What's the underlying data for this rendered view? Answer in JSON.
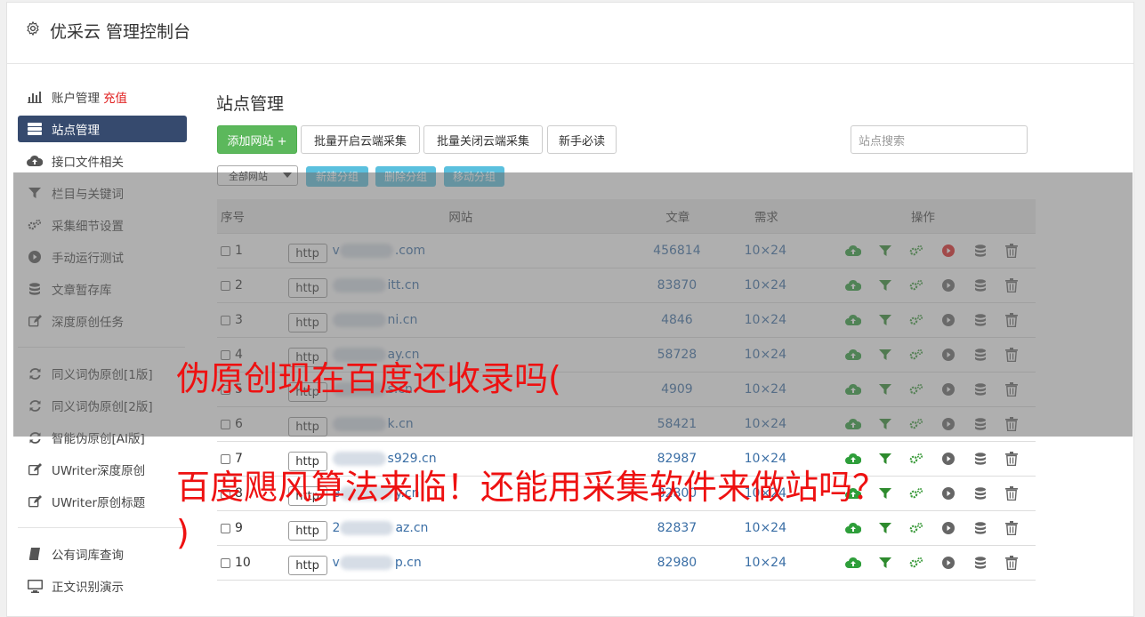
{
  "header": {
    "title": "优采云 管理控制台",
    "icon": "gear-icon"
  },
  "sidebar": {
    "items": [
      {
        "label": "账户管理",
        "extra": "充值",
        "icon": "bar-chart-icon"
      },
      {
        "label": "站点管理",
        "icon": "server-icon",
        "active": true
      },
      {
        "label": "接口文件相关",
        "icon": "cloud-upload-icon"
      },
      {
        "label": "栏目与关键词",
        "icon": "filter-icon"
      },
      {
        "label": "采集细节设置",
        "icon": "cogs-icon"
      },
      {
        "label": "手动运行测试",
        "icon": "play-icon"
      },
      {
        "label": "文章暂存库",
        "icon": "database-icon"
      },
      {
        "label": "深度原创任务",
        "icon": "edit-icon"
      }
    ],
    "items2": [
      {
        "label": "同义词伪原创[1版]",
        "icon": "refresh-icon"
      },
      {
        "label": "同义词伪原创[2版]",
        "icon": "refresh-icon"
      },
      {
        "label": "智能伪原创[AI版]",
        "icon": "refresh-icon"
      },
      {
        "label": "UWriter深度原创",
        "icon": "edit-icon"
      },
      {
        "label": "UWriter原创标题",
        "icon": "edit-icon"
      }
    ],
    "items3": [
      {
        "label": "公有词库查询",
        "icon": "book-icon"
      },
      {
        "label": "正文识别演示",
        "icon": "monitor-icon"
      }
    ]
  },
  "main": {
    "title": "站点管理",
    "buttons": {
      "add_site": "添加网站 +",
      "batch_open": "批量开启云端采集",
      "batch_close": "批量关闭云端采集",
      "newbie": "新手必读"
    },
    "search_placeholder": "站点搜索",
    "group_select": "全部网站",
    "group_buttons": {
      "new": "新建分组",
      "delete": "删除分组",
      "move": "移动分组"
    },
    "table": {
      "headers": {
        "no": "序号",
        "site": "网站",
        "articles": "文章",
        "demand": "需求",
        "ops": "操作"
      },
      "rows": [
        {
          "no": "1",
          "http": "http",
          "domain": ".com",
          "prefix": "v",
          "articles": "456814",
          "demand": "10×24",
          "play_active": true
        },
        {
          "no": "2",
          "http": "http",
          "domain": "itt.cn",
          "prefix": "",
          "articles": "83870",
          "demand": "10×24"
        },
        {
          "no": "3",
          "http": "http",
          "domain": "ni.cn",
          "prefix": "",
          "articles": "4846",
          "demand": "10×24"
        },
        {
          "no": "4",
          "http": "http",
          "domain": "ay.cn",
          "prefix": "",
          "articles": "58728",
          "demand": "10×24"
        },
        {
          "no": "5",
          "http": "http",
          "domain": "s.cn",
          "prefix": "",
          "articles": "4909",
          "demand": "10×24"
        },
        {
          "no": "6",
          "http": "http",
          "domain": "k.cn",
          "prefix": "",
          "articles": "58421",
          "demand": "10×24"
        },
        {
          "no": "7",
          "http": "http",
          "domain": "s929.cn",
          "prefix": "",
          "articles": "82987",
          "demand": "10×24"
        },
        {
          "no": "8",
          "http": "http",
          "domain": "y.cn",
          "prefix": "e",
          "articles": "82800",
          "demand": "10×24"
        },
        {
          "no": "9",
          "http": "http",
          "domain": "az.cn",
          "prefix": "2",
          "articles": "82837",
          "demand": "10×24"
        },
        {
          "no": "10",
          "http": "http",
          "domain": "p.cn",
          "prefix": "v",
          "articles": "82980",
          "demand": "10×24"
        }
      ]
    }
  },
  "overlay": {
    "line1": "伪原创现在百度还收录吗(",
    "line2": "百度飓风算法来临！还能用采集软件来做站吗？",
    "line3": ")"
  },
  "colors": {
    "accent": "#364a6e",
    "green": "#5cb85c",
    "info": "#5bc0de",
    "link": "#3a6ea5",
    "overlay_text": "#ee1111"
  }
}
